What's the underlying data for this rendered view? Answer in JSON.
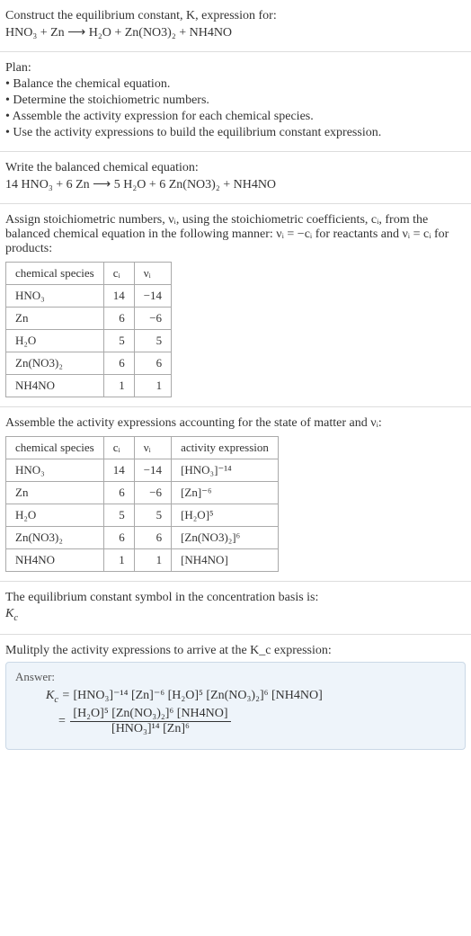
{
  "sec1": {
    "l1": "Construct the equilibrium constant, K, expression for:",
    "eq": "HNO₃ + Zn ⟶ H₂O + Zn(NO3)₂ + NH4NO"
  },
  "sec2": {
    "title": "Plan:",
    "b1": "• Balance the chemical equation.",
    "b2": "• Determine the stoichiometric numbers.",
    "b3": "• Assemble the activity expression for each chemical species.",
    "b4": "• Use the activity expressions to build the equilibrium constant expression."
  },
  "sec3": {
    "l1": "Write the balanced chemical equation:",
    "eq": "14 HNO₃ + 6 Zn ⟶ 5 H₂O + 6 Zn(NO3)₂ + NH4NO"
  },
  "sec4": {
    "intro": "Assign stoichiometric numbers, νᵢ, using the stoichiometric coefficients, cᵢ, from the balanced chemical equation in the following manner: νᵢ = −cᵢ for reactants and νᵢ = cᵢ for products:",
    "headers": {
      "h1": "chemical species",
      "h2": "cᵢ",
      "h3": "νᵢ"
    },
    "rows": [
      {
        "sp": "HNO₃",
        "c": "14",
        "v": "−14"
      },
      {
        "sp": "Zn",
        "c": "6",
        "v": "−6"
      },
      {
        "sp": "H₂O",
        "c": "5",
        "v": "5"
      },
      {
        "sp": "Zn(NO3)₂",
        "c": "6",
        "v": "6"
      },
      {
        "sp": "NH4NO",
        "c": "1",
        "v": "1"
      }
    ]
  },
  "sec5": {
    "intro": "Assemble the activity expressions accounting for the state of matter and νᵢ:",
    "headers": {
      "h1": "chemical species",
      "h2": "cᵢ",
      "h3": "νᵢ",
      "h4": "activity expression"
    },
    "rows": [
      {
        "sp": "HNO₃",
        "c": "14",
        "v": "−14",
        "a": "[HNO₃]⁻¹⁴"
      },
      {
        "sp": "Zn",
        "c": "6",
        "v": "−6",
        "a": "[Zn]⁻⁶"
      },
      {
        "sp": "H₂O",
        "c": "5",
        "v": "5",
        "a": "[H₂O]⁵"
      },
      {
        "sp": "Zn(NO3)₂",
        "c": "6",
        "v": "6",
        "a": "[Zn(NO3)₂]⁶"
      },
      {
        "sp": "NH4NO",
        "c": "1",
        "v": "1",
        "a": "[NH4NO]"
      }
    ]
  },
  "sec6": {
    "l1": "The equilibrium constant symbol in the concentration basis is:",
    "sym": "K_c"
  },
  "sec7": {
    "l1": "Mulitply the activity expressions to arrive at the K_c expression:"
  },
  "answer": {
    "title": "Answer:",
    "line1_lhs": "K_c = ",
    "line1_rhs": "[HNO₃]⁻¹⁴ [Zn]⁻⁶ [H₂O]⁵ [Zn(NO₃)₂]⁶ [NH4NO]",
    "eq_sign": " = ",
    "frac_num": "[H₂O]⁵ [Zn(NO₃)₂]⁶ [NH4NO]",
    "frac_den": "[HNO₃]¹⁴ [Zn]⁶"
  },
  "chart_data": {
    "type": "table",
    "tables": [
      {
        "title": "stoichiometric numbers",
        "columns": [
          "chemical species",
          "c_i",
          "ν_i"
        ],
        "rows": [
          [
            "HNO3",
            14,
            -14
          ],
          [
            "Zn",
            6,
            -6
          ],
          [
            "H2O",
            5,
            5
          ],
          [
            "Zn(NO3)2",
            6,
            6
          ],
          [
            "NH4NO",
            1,
            1
          ]
        ]
      },
      {
        "title": "activity expressions",
        "columns": [
          "chemical species",
          "c_i",
          "ν_i",
          "activity expression"
        ],
        "rows": [
          [
            "HNO3",
            14,
            -14,
            "[HNO3]^-14"
          ],
          [
            "Zn",
            6,
            -6,
            "[Zn]^-6"
          ],
          [
            "H2O",
            5,
            5,
            "[H2O]^5"
          ],
          [
            "Zn(NO3)2",
            6,
            6,
            "[Zn(NO3)2]^6"
          ],
          [
            "NH4NO",
            1,
            1,
            "[NH4NO]"
          ]
        ]
      }
    ]
  }
}
